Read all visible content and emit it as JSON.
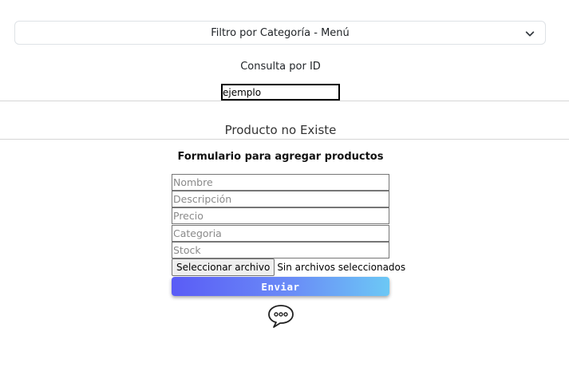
{
  "filter": {
    "selected": "Filtro por Categoría - Menú",
    "icon": "chevron-down-icon"
  },
  "consulta": {
    "label": "Consulta por ID",
    "value": "ejemplo"
  },
  "result": {
    "message": "Producto no Existe"
  },
  "form": {
    "title": "Formulario para agregar productos",
    "fields": {
      "nombre": "Nombre",
      "descripcion": "Descripción",
      "precio": "Precio",
      "categoria": "Categoria",
      "stock": "Stock"
    },
    "file": {
      "button_label": "Seleccionar archivo",
      "status": "Sin archivos seleccionados"
    },
    "submit_label": "Enviar"
  },
  "chat": {
    "icon": "chat-bubble-icon"
  },
  "colors": {
    "button_gradient_start": "#5a5cf6",
    "button_gradient_end": "#6cc8f5",
    "border": "#dee2e6"
  }
}
